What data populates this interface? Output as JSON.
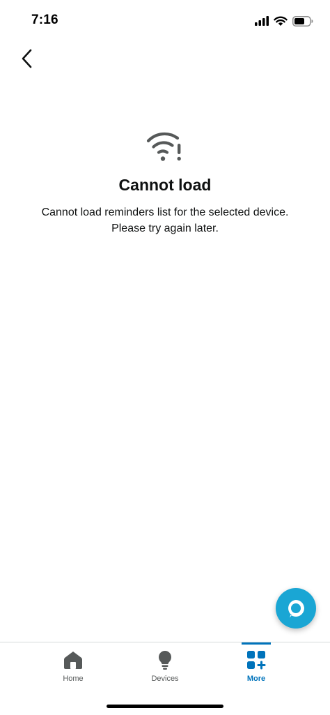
{
  "status_bar": {
    "time": "7:16"
  },
  "error": {
    "icon": "wifi-alert-icon",
    "title": "Cannot load",
    "message": "Cannot load reminders list for the selected device. Please try again later."
  },
  "tabs": [
    {
      "label": "Home",
      "icon": "home-icon",
      "active": false
    },
    {
      "label": "Devices",
      "icon": "lightbulb-icon",
      "active": false
    },
    {
      "label": "More",
      "icon": "grid-plus-icon",
      "active": true
    }
  ],
  "colors": {
    "accent": "#0073bb",
    "alexa_button": "#1aa6d4",
    "text": "#0f1111",
    "tab_inactive": "#565959"
  }
}
